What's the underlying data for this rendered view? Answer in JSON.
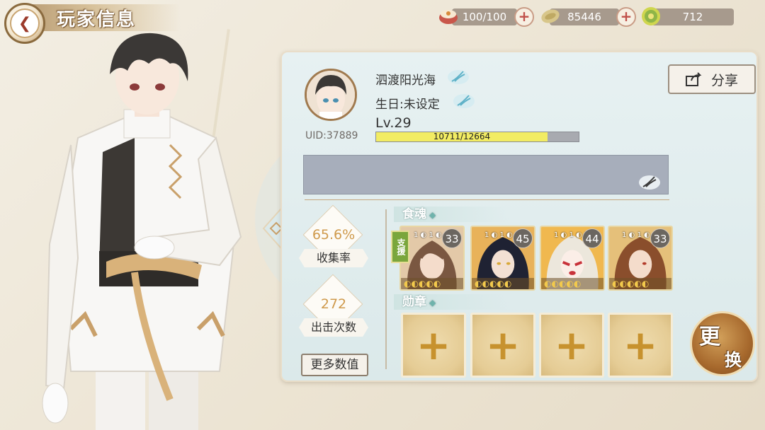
{
  "header": {
    "title": "玩家信息"
  },
  "resources": [
    {
      "icon": "food-bowl-icon",
      "value": "100/100",
      "has_plus": true
    },
    {
      "icon": "coin-icon",
      "value": "85446",
      "has_plus": true
    },
    {
      "icon": "jade-coin-icon",
      "value": "712",
      "has_plus": false
    }
  ],
  "profile": {
    "name": "泗渡阳光海",
    "birthday": "生日:未设定",
    "uid": "UID:37889",
    "level": "Lv.29",
    "xp_text": "10711/12664",
    "xp_progress": 0.846
  },
  "share": {
    "label": "分享"
  },
  "stats": {
    "collection_value": "65.6%",
    "collection_label": "收集率",
    "sorties_value": "272",
    "sorties_label": "出击次数",
    "more_label": "更多数值"
  },
  "sections": {
    "souls_label": "食魂",
    "medals_label": "勋章"
  },
  "support_tag": "支援",
  "cards": [
    {
      "level": "33",
      "minis": "1 ◐ 1 ◐",
      "bottom": "◐◐◐◐◐"
    },
    {
      "level": "45",
      "minis": "1 ◐ 1 ◐",
      "bottom": "◐◐◐◐◐"
    },
    {
      "level": "44",
      "minis": "1 ◐ 1 ◐ 2",
      "bottom": "◐◐◐◐◐"
    },
    {
      "level": "33",
      "minis": "1 ◐ 1 ◐",
      "bottom": "◐◐◐◐◐"
    }
  ],
  "change_button": {
    "line1": "更",
    "line2": "换"
  },
  "colors": {
    "accent_gold": "#cf9a4c",
    "panel_bg": "#dbe9ea",
    "xp_fill": "#f2ec63"
  }
}
